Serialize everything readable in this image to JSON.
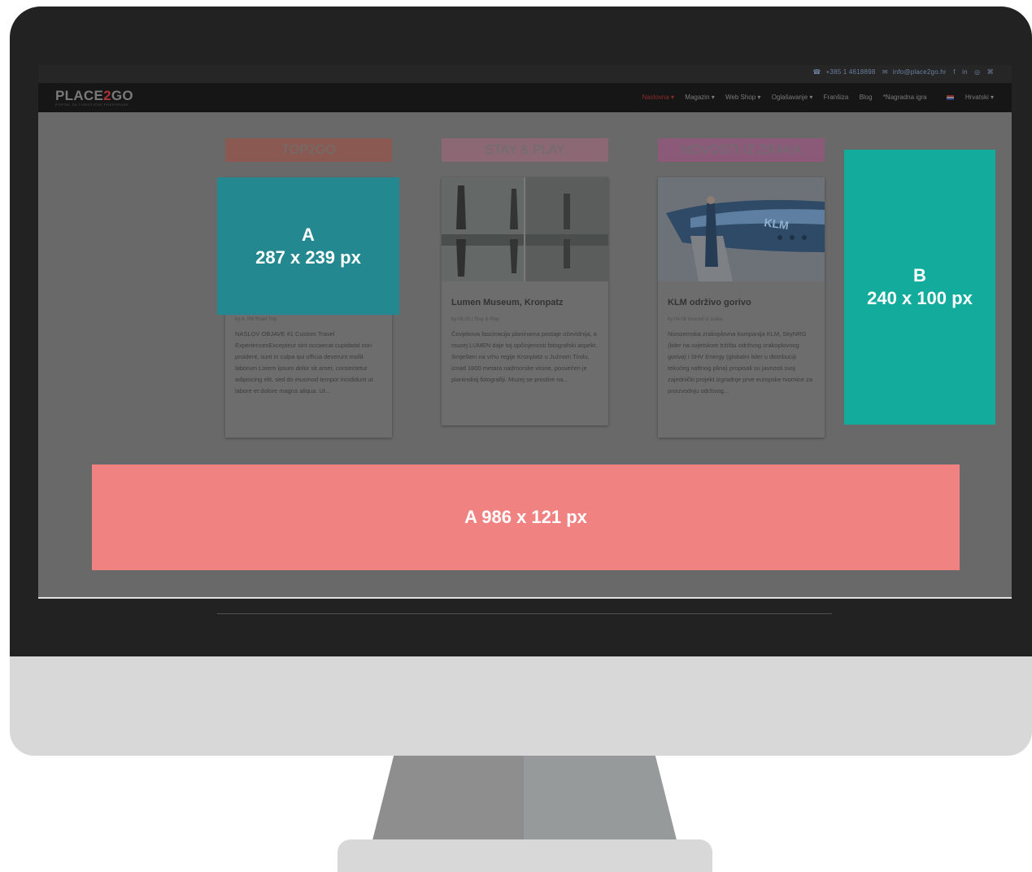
{
  "site": {
    "logo_text_a": "PLACE",
    "logo_text_b": "2",
    "logo_text_c": "GO",
    "logo_tagline": "PORTAL ZA TURISTIČKE PREPORUKE",
    "topbar": {
      "phone": "+385 1 4618898",
      "email": "info@place2go.hr",
      "social": [
        "f",
        "in",
        "◎",
        "⌘"
      ]
    },
    "menu": [
      {
        "label": "Naslovna ▾",
        "active": true
      },
      {
        "label": "Magazin ▾",
        "active": false
      },
      {
        "label": "Web Shop ▾",
        "active": false
      },
      {
        "label": "Oglašavanje ▾",
        "active": false
      },
      {
        "label": "Franšiza",
        "active": false
      },
      {
        "label": "Blog",
        "active": false
      },
      {
        "label": "*Nagradna igra",
        "active": false
      },
      {
        "label": "Hrvatski ▾",
        "active": false
      }
    ]
  },
  "columns": [
    {
      "category": "TOP2GO",
      "category_color": "#8a5a52",
      "title": "",
      "meta": "by A. Ptil   Road Trip",
      "text": "NASLOV OBJAVE #1 Custom Travel ExperiencesExcepteur sint occaecat cupidatat non proident, sunt in culpa qui officia deserunt mollit laborum Lorem ipsum dolor sit amet, consectetur adipiscing elit, sed do eiusmod tempor incididunt ut labore et dolore magna aliqua. Ut..."
    },
    {
      "category": "STAY & PLAY",
      "category_color": "#8b6874",
      "title": "Lumen Museum, Kronpatz",
      "meta": "by   08.05 | Stay & Play",
      "text": "Čovjekova fascinacija planinama postaje očevidnija, a muzej LUMEN daje toj opčinjenosti fotografski aspekt. Smješten na vrhu regije Kronplatz u Južnom Tirolu, iznad 1800 metara nadmorske visine, posvećen je planinskoj fotografiji. Muzej se prostire na..."
    },
    {
      "category": "NOVOSTI IZ ZRAKA",
      "category_color": "#8b5a79",
      "title": "KLM održivo gorivo",
      "meta": "by   04.08   Novosti iz zraka",
      "text": "Nizozemska zrakoplovna kompanija KLM, SkyNRG (lider na svjetskom tržištu održivog zrakoplovnog goriva) i SHV Energy (globalni lider u distribuciji tekućeg naftnog plina) propisali su javnosti svoj zajednički projekt izgradnje prve europske tvornice za proizvodnju održivog..."
    }
  ],
  "ads": [
    {
      "label_line1": "A",
      "label_line2": "287 x 239 px",
      "color": "#23888f"
    },
    {
      "label_line1": "B",
      "label_line2": "240 x 100 px",
      "color": "#13ab9b"
    },
    {
      "label_line1": "A 986 x 121 px",
      "label_line2": "",
      "color": "#f08281"
    }
  ]
}
